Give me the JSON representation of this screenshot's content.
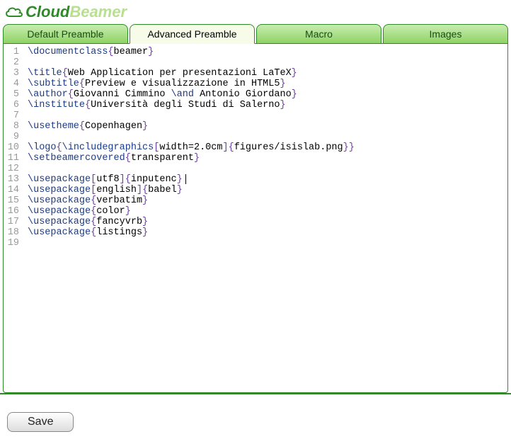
{
  "app": {
    "brand_first": "Cloud",
    "brand_second": "Beamer"
  },
  "tabs": [
    {
      "label": "Default Preamble",
      "active": false
    },
    {
      "label": "Advanced Preamble",
      "active": true
    },
    {
      "label": "Macro",
      "active": false
    },
    {
      "label": "Images",
      "active": false
    }
  ],
  "editor": {
    "line_numbers": [
      "1",
      "2",
      "3",
      "4",
      "5",
      "6",
      "7",
      "8",
      "9",
      "10",
      "11",
      "12",
      "13",
      "14",
      "15",
      "16",
      "17",
      "18",
      "19"
    ],
    "lines": [
      [
        {
          "t": "cmd",
          "v": "\\documentclass"
        },
        {
          "t": "brace",
          "v": "{"
        },
        {
          "t": "txt",
          "v": "beamer"
        },
        {
          "t": "brace",
          "v": "}"
        }
      ],
      [],
      [
        {
          "t": "cmd",
          "v": "\\title"
        },
        {
          "t": "brace",
          "v": "{"
        },
        {
          "t": "txt",
          "v": "Web Application per presentazioni LaTeX"
        },
        {
          "t": "brace",
          "v": "}"
        }
      ],
      [
        {
          "t": "cmd",
          "v": "\\subtitle"
        },
        {
          "t": "brace",
          "v": "{"
        },
        {
          "t": "txt",
          "v": "Preview e visualizzazione in HTML5"
        },
        {
          "t": "brace",
          "v": "}"
        }
      ],
      [
        {
          "t": "cmd",
          "v": "\\author"
        },
        {
          "t": "brace",
          "v": "{"
        },
        {
          "t": "txt",
          "v": "Giovanni Cimmino "
        },
        {
          "t": "cmd",
          "v": "\\and"
        },
        {
          "t": "txt",
          "v": " Antonio Giordano"
        },
        {
          "t": "brace",
          "v": "}"
        }
      ],
      [
        {
          "t": "cmd",
          "v": "\\institute"
        },
        {
          "t": "brace",
          "v": "{"
        },
        {
          "t": "txt",
          "v": "Università degli Studi di Salerno"
        },
        {
          "t": "brace",
          "v": "}"
        }
      ],
      [],
      [
        {
          "t": "cmd",
          "v": "\\usetheme"
        },
        {
          "t": "brace",
          "v": "{"
        },
        {
          "t": "txt",
          "v": "Copenhagen"
        },
        {
          "t": "brace",
          "v": "}"
        }
      ],
      [],
      [
        {
          "t": "cmd",
          "v": "\\logo"
        },
        {
          "t": "brace",
          "v": "{"
        },
        {
          "t": "cmd",
          "v": "\\includegraphics"
        },
        {
          "t": "bracket",
          "v": "["
        },
        {
          "t": "txt",
          "v": "width=2.0cm"
        },
        {
          "t": "bracket",
          "v": "]"
        },
        {
          "t": "brace",
          "v": "{"
        },
        {
          "t": "txt",
          "v": "figures/isislab.png"
        },
        {
          "t": "brace",
          "v": "}"
        },
        {
          "t": "brace",
          "v": "}"
        }
      ],
      [
        {
          "t": "cmd",
          "v": "\\setbeamercovered"
        },
        {
          "t": "brace",
          "v": "{"
        },
        {
          "t": "txt",
          "v": "transparent"
        },
        {
          "t": "brace",
          "v": "}"
        }
      ],
      [],
      [
        {
          "t": "cmd",
          "v": "\\usepackage"
        },
        {
          "t": "bracket",
          "v": "["
        },
        {
          "t": "txt",
          "v": "utf8"
        },
        {
          "t": "bracket",
          "v": "]"
        },
        {
          "t": "brace",
          "v": "{"
        },
        {
          "t": "txt",
          "v": "inputenc"
        },
        {
          "t": "brace",
          "v": "}"
        },
        {
          "t": "cursor",
          "v": ""
        }
      ],
      [
        {
          "t": "cmd",
          "v": "\\usepackage"
        },
        {
          "t": "bracket",
          "v": "["
        },
        {
          "t": "txt",
          "v": "english"
        },
        {
          "t": "bracket",
          "v": "]"
        },
        {
          "t": "brace",
          "v": "{"
        },
        {
          "t": "txt",
          "v": "babel"
        },
        {
          "t": "brace",
          "v": "}"
        }
      ],
      [
        {
          "t": "cmd",
          "v": "\\usepackage"
        },
        {
          "t": "brace",
          "v": "{"
        },
        {
          "t": "txt",
          "v": "verbatim"
        },
        {
          "t": "brace",
          "v": "}"
        }
      ],
      [
        {
          "t": "cmd",
          "v": "\\usepackage"
        },
        {
          "t": "brace",
          "v": "{"
        },
        {
          "t": "txt",
          "v": "color"
        },
        {
          "t": "brace",
          "v": "}"
        }
      ],
      [
        {
          "t": "cmd",
          "v": "\\usepackage"
        },
        {
          "t": "brace",
          "v": "{"
        },
        {
          "t": "txt",
          "v": "fancyvrb"
        },
        {
          "t": "brace",
          "v": "}"
        }
      ],
      [
        {
          "t": "cmd",
          "v": "\\usepackage"
        },
        {
          "t": "brace",
          "v": "{"
        },
        {
          "t": "txt",
          "v": "listings"
        },
        {
          "t": "brace",
          "v": "}"
        }
      ],
      []
    ]
  },
  "footer": {
    "save_label": "Save"
  }
}
